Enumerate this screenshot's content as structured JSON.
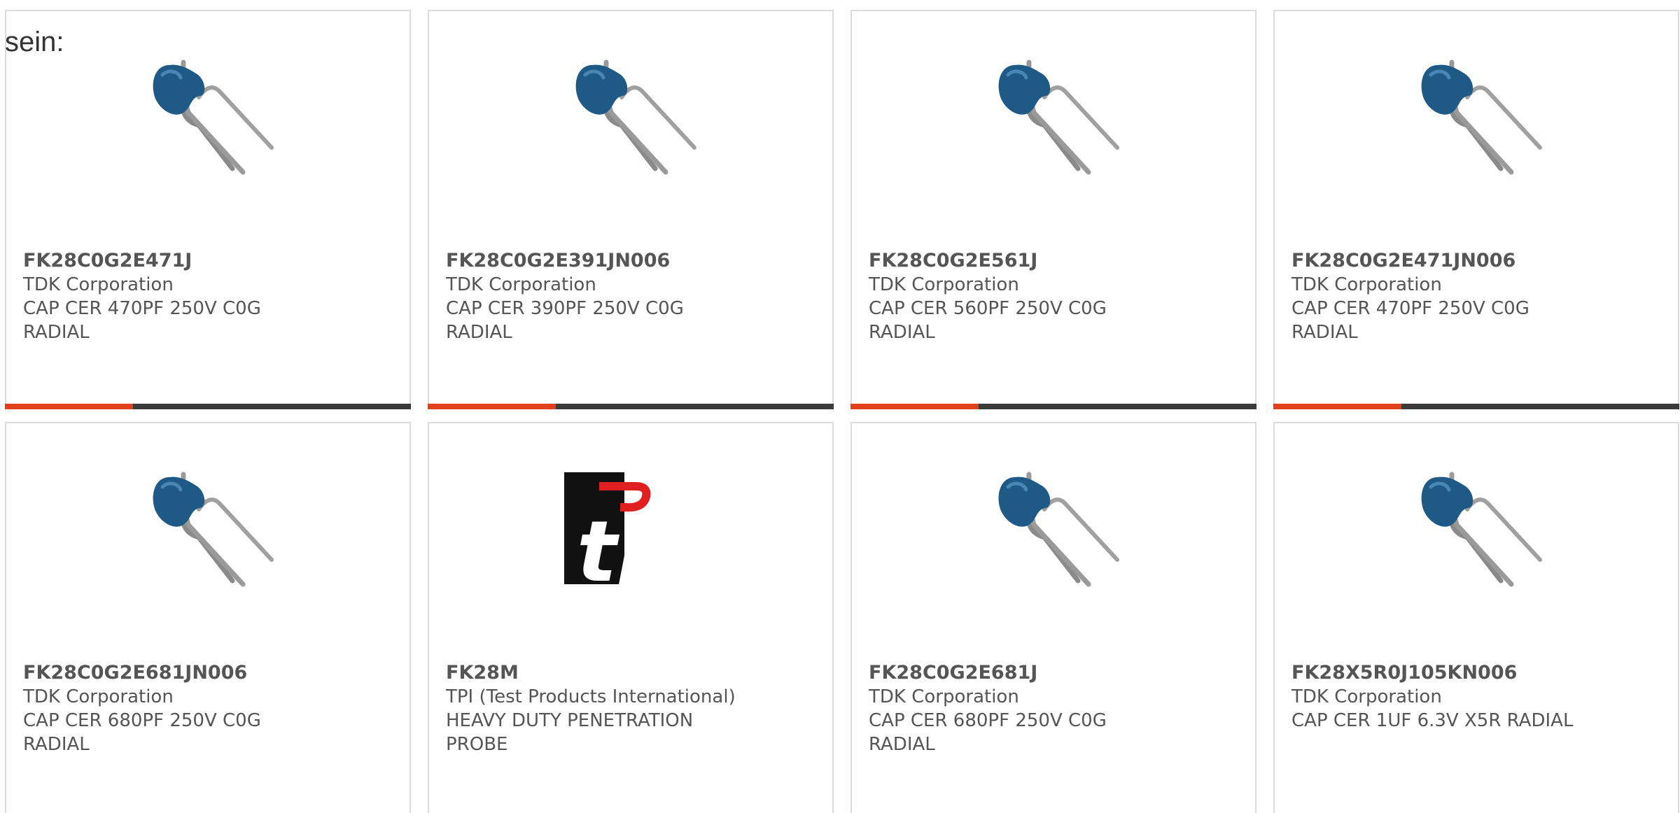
{
  "heading": "sein:",
  "colors": {
    "accent": "#e0401a",
    "bar": "#3a3a3a",
    "capacitor_body": "#1f5a86",
    "logo_red": "#e02020",
    "logo_black": "#111111"
  },
  "cards": [
    {
      "part": "FK28C0G2E471J",
      "manufacturer": "TDK Corporation",
      "desc": "CAP CER 470PF 250V C0G",
      "desc2": "RADIAL",
      "image": "capacitor-icon"
    },
    {
      "part": "FK28C0G2E391JN006",
      "manufacturer": "TDK Corporation",
      "desc": "CAP CER 390PF 250V C0G",
      "desc2": "RADIAL",
      "image": "capacitor-icon"
    },
    {
      "part": "FK28C0G2E561J",
      "manufacturer": "TDK Corporation",
      "desc": "CAP CER 560PF 250V C0G",
      "desc2": "RADIAL",
      "image": "capacitor-icon"
    },
    {
      "part": "FK28C0G2E471JN006",
      "manufacturer": "TDK Corporation",
      "desc": "CAP CER 470PF 250V C0G",
      "desc2": "RADIAL",
      "image": "capacitor-icon"
    },
    {
      "part": "FK28C0G2E681JN006",
      "manufacturer": "TDK Corporation",
      "desc": "CAP CER 680PF 250V C0G",
      "desc2": "RADIAL",
      "image": "capacitor-icon"
    },
    {
      "part": "FK28M",
      "manufacturer": "TPI (Test Products International)",
      "desc": "HEAVY DUTY PENETRATION",
      "desc2": "PROBE",
      "image": "tpi-logo",
      "logo_text": "tpi"
    },
    {
      "part": "FK28C0G2E681J",
      "manufacturer": "TDK Corporation",
      "desc": "CAP CER 680PF 250V C0G",
      "desc2": "RADIAL",
      "image": "capacitor-icon"
    },
    {
      "part": "FK28X5R0J105KN006",
      "manufacturer": "TDK Corporation",
      "desc": "CAP CER 1UF 6.3V X5R RADIAL",
      "desc2": "",
      "image": "capacitor-icon"
    }
  ]
}
